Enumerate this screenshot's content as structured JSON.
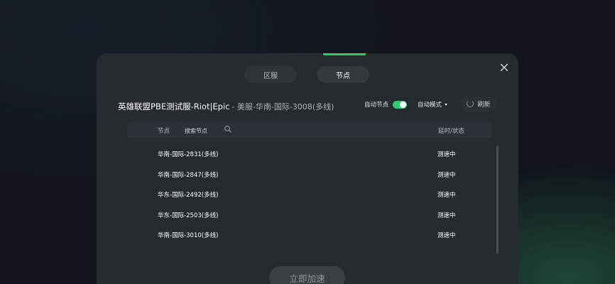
{
  "dialog": {
    "tabs": [
      {
        "label": "区服",
        "active": false
      },
      {
        "label": "节点",
        "active": true
      }
    ],
    "title": {
      "main": "英雄联盟PBE测试服-Riot|Epic",
      "sub": "- 美服-华南-国际-3008(多线)"
    },
    "controls": {
      "auto_node_label": "自动节点",
      "auto_node_on": true,
      "auto_mode_label": "自动模式",
      "refresh_label": "刷新"
    },
    "list": {
      "header_node": "节点",
      "search_placeholder": "搜索节点",
      "header_delay": "延时/状态",
      "rows": [
        {
          "name": "华南-国际-2831(多线)",
          "status": "测速中"
        },
        {
          "name": "华南-国际-2847(多线)",
          "status": "测速中"
        },
        {
          "name": "华东-国际-2492(多线)",
          "status": "测速中"
        },
        {
          "name": "华东-国际-2503(多线)",
          "status": "测速中"
        },
        {
          "name": "华南-国际-3010(多线)",
          "status": "测速中"
        }
      ]
    },
    "accelerate_label": "立即加速"
  },
  "colors": {
    "accent": "#2ecc71",
    "dialog_bg": "#262b30"
  }
}
